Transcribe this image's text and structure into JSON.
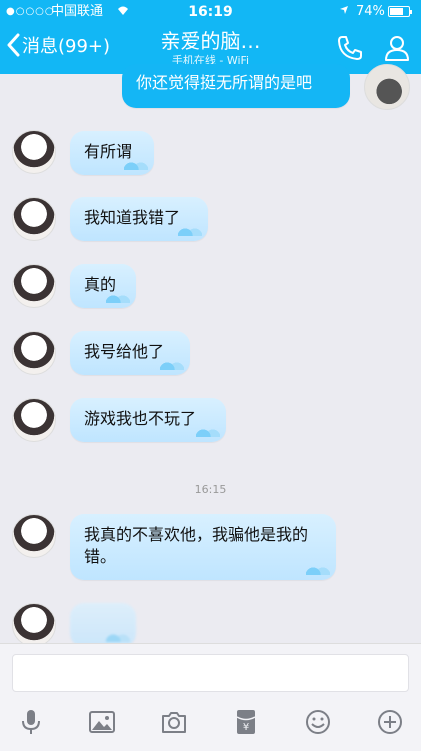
{
  "status_bar": {
    "signal": "●○○○○",
    "carrier": "中国联通",
    "wifi": "wifi",
    "time": "16:19",
    "location": "location-arrow",
    "battery": "74%",
    "battery_level": 0.74
  },
  "header": {
    "back_label": "消息(99+)",
    "back_chevron": "<",
    "title": "亲爱的脑…",
    "subtitle": "手机在线 - WiFi"
  },
  "messages": [
    {
      "from": "me",
      "text": "你还觉得挺无所谓的是吧"
    },
    {
      "from": "friend",
      "text": "有所谓"
    },
    {
      "from": "friend",
      "text": "我知道我错了"
    },
    {
      "from": "friend",
      "text": "真的"
    },
    {
      "from": "friend",
      "text": "我号给他了"
    },
    {
      "from": "friend",
      "text": "游戏我也不玩了"
    },
    {
      "from": "friend",
      "text": "我真的不喜欢他，我骗他是我的错。"
    }
  ],
  "timestamp": "16:15",
  "input": {
    "value": "",
    "placeholder": ""
  },
  "toolbar": [
    "microphone-icon",
    "image-icon",
    "camera-icon",
    "red-packet-icon",
    "emoji-icon",
    "plus-icon"
  ],
  "colors": {
    "header_bg": "#12b7f5",
    "outgoing_bubble": "#14b6f5",
    "incoming_bubble": "#c9eaff",
    "background": "#ebebf1",
    "icon_gray": "#7c7f87"
  }
}
